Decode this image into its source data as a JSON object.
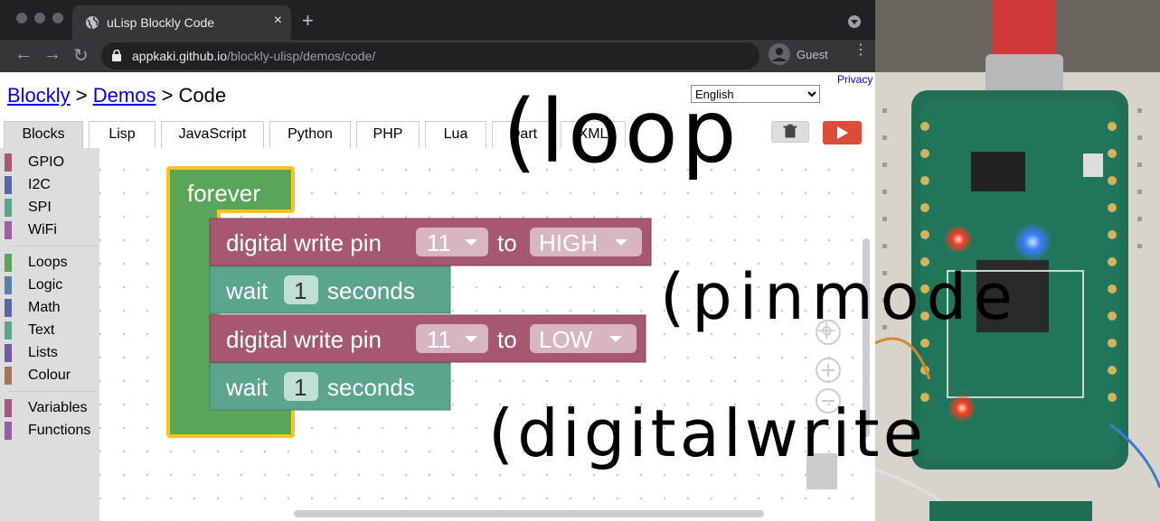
{
  "browser": {
    "tab_title": "uLisp Blockly Code",
    "tab_close": "×",
    "new_tab": "+",
    "back": "←",
    "forward": "→",
    "reload": "↻",
    "url_host": "appkaki.github.io",
    "url_path": "/blockly-ulisp/demos/code/",
    "profile_label": "Guest",
    "menu": "⋮"
  },
  "page": {
    "breadcrumb": {
      "link1": "Blockly",
      "sep1": " > ",
      "link2": "Demos",
      "sep2": " > ",
      "current": "Code"
    },
    "privacy": "Privacy",
    "language": "English",
    "tabs": [
      "Blocks",
      "Lisp",
      "JavaScript",
      "Python",
      "PHP",
      "Lua",
      "Dart",
      "XML"
    ]
  },
  "toolbox": {
    "groups": [
      [
        {
          "label": "GPIO",
          "color": "#a5586e"
        },
        {
          "label": "I2C",
          "color": "#5b67a5"
        },
        {
          "label": "SPI",
          "color": "#5ba58c"
        },
        {
          "label": "WiFi",
          "color": "#a55ba5"
        }
      ],
      [
        {
          "label": "Loops",
          "color": "#5ba55b"
        },
        {
          "label": "Logic",
          "color": "#5b80a5"
        },
        {
          "label": "Math",
          "color": "#5b67a5"
        },
        {
          "label": "Text",
          "color": "#5ba58c"
        },
        {
          "label": "Lists",
          "color": "#745ba5"
        },
        {
          "label": "Colour",
          "color": "#a5745b"
        }
      ],
      [
        {
          "label": "Variables",
          "color": "#a55b80"
        },
        {
          "label": "Functions",
          "color": "#995ba5"
        }
      ]
    ]
  },
  "blocks": {
    "forever": "forever",
    "write1": {
      "text": "digital write pin",
      "pin": "11",
      "to": "to",
      "level": "HIGH"
    },
    "wait1": {
      "text": "wait",
      "value": "1",
      "unit": "seconds"
    },
    "write2": {
      "text": "digital write pin",
      "pin": "11",
      "to": "to",
      "level": "LOW"
    },
    "wait2": {
      "text": "wait",
      "value": "1",
      "unit": "seconds"
    },
    "colors": {
      "loop": "#5ba55b",
      "gpio": "#a5586e",
      "timing": "#5ba58c",
      "field": "#d7b6c2",
      "highlight": "#fcc419"
    }
  },
  "handwriting": {
    "loop": "(loop",
    "pinmode": "(pinmode",
    "digitalwrite": "(digitalwrite"
  }
}
